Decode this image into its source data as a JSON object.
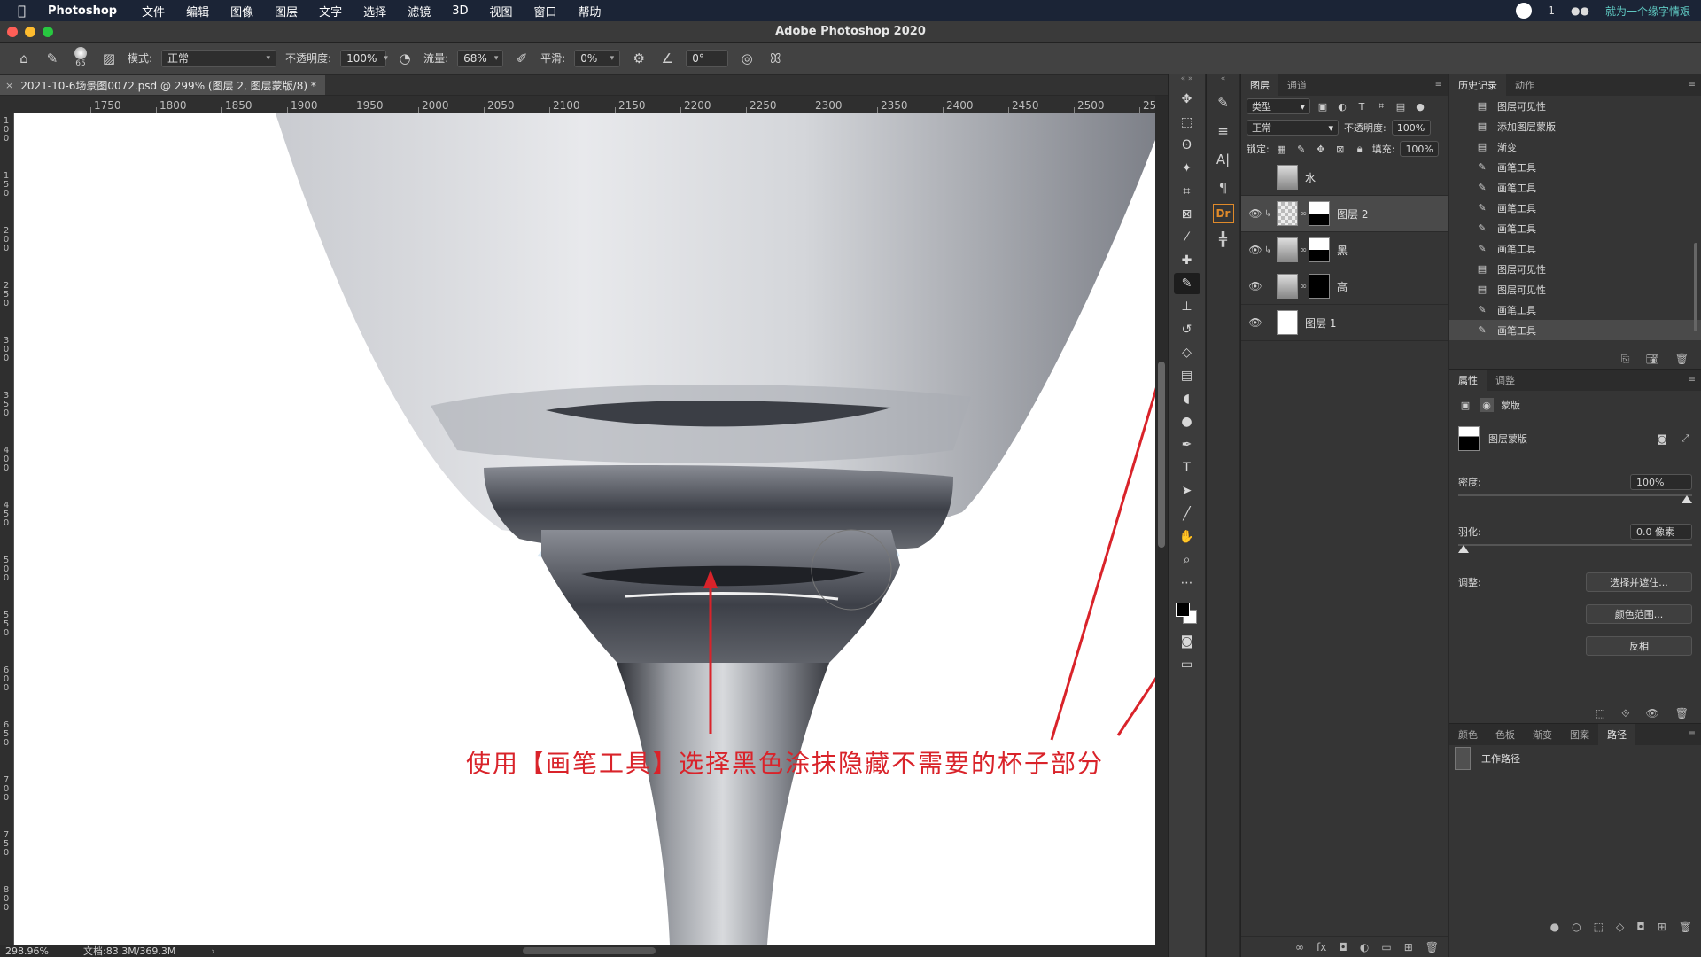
{
  "menubar": {
    "app_name": "Photoshop",
    "menus": [
      "文件",
      "编辑",
      "图像",
      "图层",
      "文字",
      "选择",
      "滤镜",
      "3D",
      "视图",
      "窗口",
      "帮助"
    ],
    "status_count": "1",
    "right_note": "就为一个缘字情艰"
  },
  "window": {
    "title": "Adobe Photoshop 2020"
  },
  "options": {
    "brush_size": "65",
    "mode_label": "模式:",
    "mode_value": "正常",
    "opacity_label": "不透明度:",
    "opacity_value": "100%",
    "flow_label": "流量:",
    "flow_value": "68%",
    "smoothing_label": "平滑:",
    "smoothing_value": "0%",
    "angle_value": "0°"
  },
  "document": {
    "tab_title": "2021-10-6场景图0072.psd @ 299% (图层 2, 图层蒙版/8) *",
    "close_glyph": "×",
    "ruler_h": [
      "1750",
      "1800",
      "1850",
      "1900",
      "1950",
      "2000",
      "2050",
      "2100",
      "2150",
      "2200",
      "2250",
      "2300",
      "2350",
      "2400",
      "2450",
      "2500",
      "25"
    ],
    "ruler_v": [
      "100",
      "150",
      "200",
      "250",
      "300",
      "350",
      "400",
      "450",
      "500",
      "550",
      "600",
      "650",
      "700",
      "750",
      "800"
    ],
    "annotation": "使用【画笔工具】选择黑色涂抹隐藏不需要的杯子部分"
  },
  "status": {
    "zoom": "298.96%",
    "doc_size": "文档:83.3M/369.3M",
    "arrow": "›"
  },
  "layers_panel": {
    "tabs": [
      "图层",
      "通道"
    ],
    "filter_kind": "类型",
    "blend_mode": "正常",
    "opacity_label": "不透明度:",
    "opacity_value": "100%",
    "lock_label": "锁定:",
    "fill_label": "填充:",
    "fill_value": "100%",
    "layers": [
      {
        "name": "水",
        "visible": false
      },
      {
        "name": "图层 2",
        "visible": true,
        "selected": true
      },
      {
        "name": "黑",
        "visible": true
      },
      {
        "name": "高",
        "visible": true
      },
      {
        "name": "图层 1",
        "visible": true
      }
    ]
  },
  "history_panel": {
    "tabs": [
      "历史记录",
      "动作"
    ],
    "items": [
      "图层可见性",
      "添加图层蒙版",
      "渐变",
      "画笔工具",
      "画笔工具",
      "画笔工具",
      "画笔工具",
      "画笔工具",
      "图层可见性",
      "图层可见性",
      "画笔工具",
      "画笔工具"
    ]
  },
  "properties_panel": {
    "tabs": [
      "属性",
      "调整"
    ],
    "kind_label": "蒙版",
    "mask_name": "图层蒙版",
    "density_label": "密度:",
    "density_value": "100%",
    "density_fraction": 1.0,
    "feather_label": "羽化:",
    "feather_value": "0.0 像素",
    "feather_fraction": 0.0,
    "adjust_label": "调整:",
    "buttons": [
      "选择并遮住...",
      "颜色范围...",
      "反相"
    ]
  },
  "bottom_panel": {
    "tabs": [
      "颜色",
      "色板",
      "渐变",
      "图案",
      "路径"
    ],
    "path_item": "工作路径"
  },
  "colors": {
    "menubar_bg": "#1b2436",
    "annotation_red": "#d9232a",
    "foreground": "#000000",
    "background": "#ffffff"
  }
}
